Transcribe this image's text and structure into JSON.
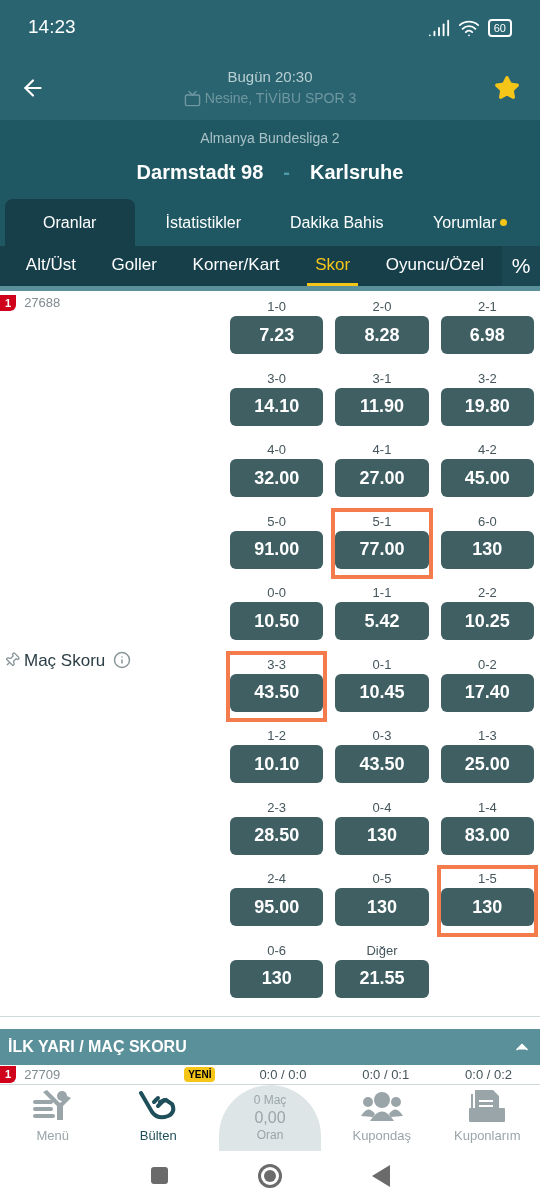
{
  "status_bar": {
    "time": "14:23",
    "battery": "60"
  },
  "header": {
    "time": "Bugün 20:30",
    "channels": "Nesine, TİVİBU SPOR 3",
    "favorite": true
  },
  "match": {
    "league": "Almanya Bundesliga 2",
    "home": "Darmstadt 98",
    "separator": "-",
    "away": "Karlsruhe"
  },
  "tabs": [
    {
      "label": "Oranlar",
      "selected": true,
      "dot": false
    },
    {
      "label": "İstatistikler",
      "selected": false,
      "dot": false
    },
    {
      "label": "Dakika Bahis",
      "selected": false,
      "dot": false
    },
    {
      "label": "Yorumlar",
      "selected": false,
      "dot": true
    }
  ],
  "subtabs": [
    {
      "label": "Alt/Üst",
      "selected": false
    },
    {
      "label": "Goller",
      "selected": false
    },
    {
      "label": "Korner/Kart",
      "selected": false
    },
    {
      "label": "Skor",
      "selected": true
    },
    {
      "label": "Oyuncu/Özel",
      "selected": false
    }
  ],
  "percent_button": "%",
  "market": {
    "mbs": "1",
    "code": "27688",
    "name": "Maç Skoru",
    "odds": [
      {
        "label": "1-0",
        "value": "7.23",
        "highlighted": false
      },
      {
        "label": "2-0",
        "value": "8.28",
        "highlighted": false
      },
      {
        "label": "2-1",
        "value": "6.98",
        "highlighted": false
      },
      {
        "label": "3-0",
        "value": "14.10",
        "highlighted": false
      },
      {
        "label": "3-1",
        "value": "11.90",
        "highlighted": false
      },
      {
        "label": "3-2",
        "value": "19.80",
        "highlighted": false
      },
      {
        "label": "4-0",
        "value": "32.00",
        "highlighted": false
      },
      {
        "label": "4-1",
        "value": "27.00",
        "highlighted": false
      },
      {
        "label": "4-2",
        "value": "45.00",
        "highlighted": false
      },
      {
        "label": "5-0",
        "value": "91.00",
        "highlighted": false
      },
      {
        "label": "5-1",
        "value": "77.00",
        "highlighted": true
      },
      {
        "label": "6-0",
        "value": "130",
        "highlighted": false
      },
      {
        "label": "0-0",
        "value": "10.50",
        "highlighted": false
      },
      {
        "label": "1-1",
        "value": "5.42",
        "highlighted": false
      },
      {
        "label": "2-2",
        "value": "10.25",
        "highlighted": false
      },
      {
        "label": "3-3",
        "value": "43.50",
        "highlighted": true
      },
      {
        "label": "0-1",
        "value": "10.45",
        "highlighted": false
      },
      {
        "label": "0-2",
        "value": "17.40",
        "highlighted": false
      },
      {
        "label": "1-2",
        "value": "10.10",
        "highlighted": false
      },
      {
        "label": "0-3",
        "value": "43.50",
        "highlighted": false
      },
      {
        "label": "1-3",
        "value": "25.00",
        "highlighted": false
      },
      {
        "label": "2-3",
        "value": "28.50",
        "highlighted": false
      },
      {
        "label": "0-4",
        "value": "130",
        "highlighted": false
      },
      {
        "label": "1-4",
        "value": "83.00",
        "highlighted": false
      },
      {
        "label": "2-4",
        "value": "95.00",
        "highlighted": false
      },
      {
        "label": "0-5",
        "value": "130",
        "highlighted": false
      },
      {
        "label": "1-5",
        "value": "130",
        "highlighted": true
      },
      {
        "label": "0-6",
        "value": "130",
        "highlighted": false
      },
      {
        "label": "Diğer",
        "value": "21.55",
        "highlighted": false
      }
    ]
  },
  "next_market": {
    "title": "İLK YARI / MAÇ SKORU",
    "expanded": true,
    "mbs": "1",
    "code": "27709",
    "badge": "YENİ",
    "labels": [
      "0:0 / 0:0",
      "0:0 / 0:1",
      "0:0 / 0:2"
    ]
  },
  "bottom_nav": [
    {
      "kind": "menu",
      "label": "Menü",
      "selected": false
    },
    {
      "kind": "bulletin",
      "label": "Bülten",
      "selected": true
    },
    {
      "kind": "coupon",
      "count": "0 Maç",
      "odds": "0,00",
      "label": "Oran",
      "selected": false
    },
    {
      "kind": "social",
      "label": "Kupondaş",
      "selected": false
    },
    {
      "kind": "mycoupons",
      "label": "Kuponlarım",
      "selected": false
    }
  ]
}
